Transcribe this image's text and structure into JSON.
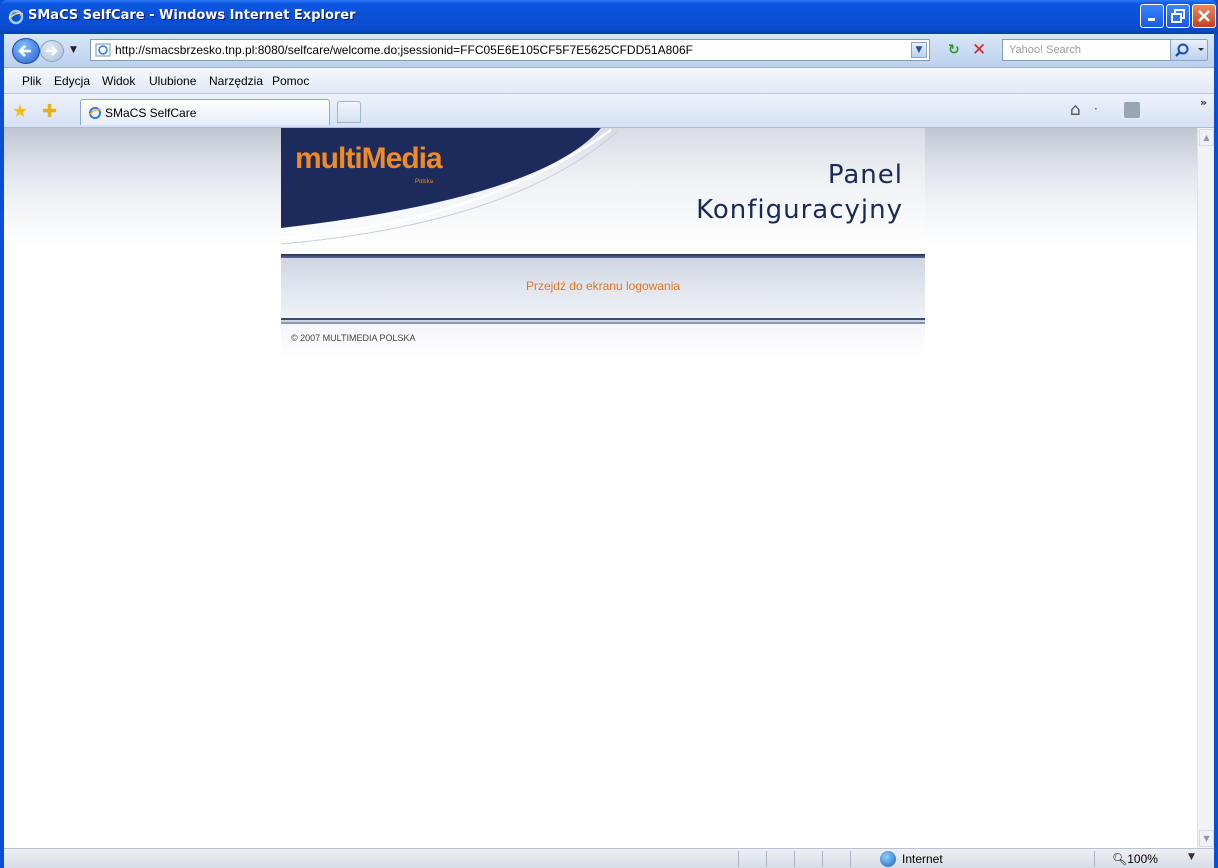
{
  "window": {
    "title": "SMaCS SelfCare - Windows Internet Explorer"
  },
  "addressbar": {
    "url": "http://smacsbrzesko.tnp.pl:8080/selfcare/welcome.do;jsessionid=FFC05E6E105CF5F7E5625CFDD51A806F",
    "search_placeholder": "Yahoo! Search"
  },
  "menubar": {
    "items": [
      "Plik",
      "Edycja",
      "Widok",
      "Ulubione",
      "Narzędzia",
      "Pomoc"
    ]
  },
  "tabs": [
    {
      "label": "SMaCS SelfCare"
    }
  ],
  "page": {
    "logo_text": "multiMedia",
    "logo_subtext": "Polska",
    "title_line1": "Panel",
    "title_line2": "Konfiguracyjny",
    "login_link": "Przejdź do ekranu logowania",
    "footer": "© 2007 MULTIMEDIA POLSKA"
  },
  "statusbar": {
    "zone": "Internet",
    "zoom": "100%"
  },
  "colors": {
    "accent_orange": "#e2761e",
    "navy": "#1a2a56",
    "titlebar_blue": "#0a50d8"
  }
}
